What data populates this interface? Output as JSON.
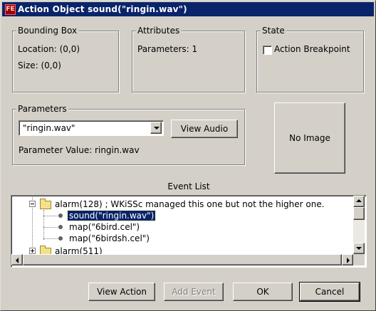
{
  "window": {
    "title": "Action Object  sound(\"ringin.wav\")",
    "icon": "app-icon",
    "icon_glyph": "FE"
  },
  "bounding_box": {
    "title": "Bounding Box",
    "location": "Location:  (0,0)",
    "size": "Size:  (0,0)"
  },
  "attributes": {
    "title": "Attributes",
    "parameters": "Parameters:  1"
  },
  "state": {
    "title": "State",
    "action_breakpoint_label": "Action Breakpoint",
    "action_breakpoint_checked": false
  },
  "parameters": {
    "title": "Parameters",
    "selected_value": "\"ringin.wav\"",
    "view_audio_label": "View Audio",
    "parameter_value_text": "Parameter Value:  ringin.wav"
  },
  "image_preview": {
    "label": "No Image"
  },
  "event_list": {
    "title": "Event List",
    "rows": [
      {
        "text": "alarm(128) ; WKiSSc managed this one but not the higher one.",
        "kind": "folder",
        "expanded": true
      },
      {
        "text": "sound(\"ringin.wav\")",
        "kind": "leaf",
        "selected": true
      },
      {
        "text": "map(\"6bird.cel\")",
        "kind": "leaf"
      },
      {
        "text": "map(\"6birdsh.cel\")",
        "kind": "leaf"
      },
      {
        "text": "alarm(511)",
        "kind": "folder",
        "expanded": false
      }
    ]
  },
  "footer": {
    "view_action_label": "View Action",
    "add_event_label": "Add Event",
    "add_event_enabled": false,
    "ok_label": "OK",
    "cancel_label": "Cancel"
  },
  "colors": {
    "titlebar": "#0a246a",
    "face": "#d4d0c8",
    "selection": "#0a246a"
  }
}
